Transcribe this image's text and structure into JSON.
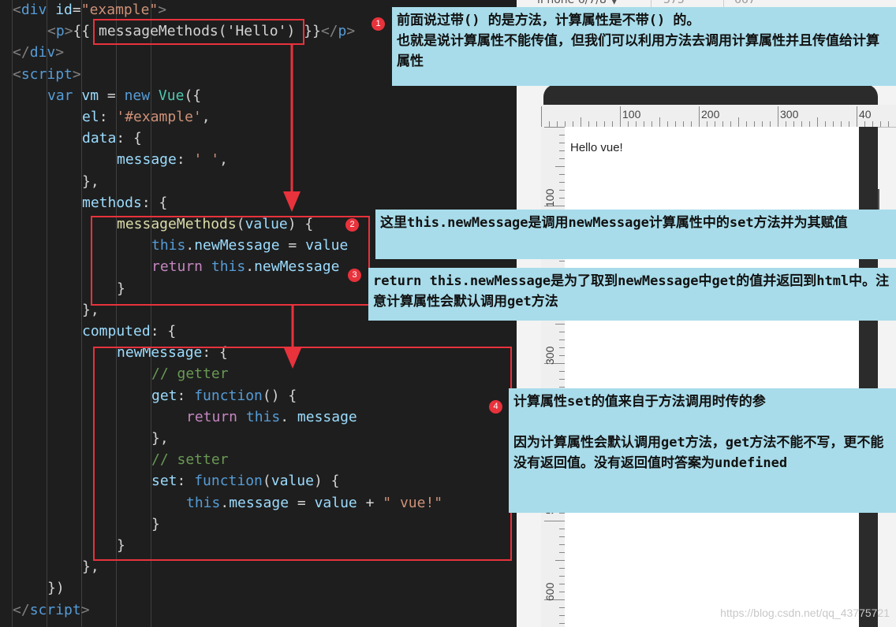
{
  "code": {
    "lines": [
      {
        "indent": 0,
        "tokens": [
          {
            "t": "<",
            "c": "punc"
          },
          {
            "t": "div ",
            "c": "tag"
          },
          {
            "t": "id",
            "c": "attr"
          },
          {
            "t": "=",
            "c": "txt"
          },
          {
            "t": "\"example\"",
            "c": "str"
          },
          {
            "t": ">",
            "c": "punc"
          }
        ]
      },
      {
        "indent": 1,
        "tokens": [
          {
            "t": "<",
            "c": "punc"
          },
          {
            "t": "p",
            "c": "tag"
          },
          {
            "t": ">",
            "c": "punc"
          },
          {
            "t": "{{ ",
            "c": "txt"
          },
          {
            "t": "messageMethods",
            "c": "txt"
          },
          {
            "t": "(",
            "c": "txt"
          },
          {
            "t": "'Hello'",
            "c": "txt"
          },
          {
            "t": ")",
            "c": "txt"
          },
          {
            "t": " }}",
            "c": "txt"
          },
          {
            "t": "</",
            "c": "punc"
          },
          {
            "t": "p",
            "c": "tag"
          },
          {
            "t": ">",
            "c": "punc"
          }
        ]
      },
      {
        "indent": 0,
        "tokens": [
          {
            "t": "</",
            "c": "punc"
          },
          {
            "t": "div",
            "c": "tag"
          },
          {
            "t": ">",
            "c": "punc"
          }
        ]
      },
      {
        "indent": 0,
        "tokens": [
          {
            "t": "<",
            "c": "punc"
          },
          {
            "t": "script",
            "c": "tag"
          },
          {
            "t": ">",
            "c": "punc"
          }
        ]
      },
      {
        "indent": 1,
        "tokens": [
          {
            "t": "var ",
            "c": "kw"
          },
          {
            "t": "vm",
            "c": "var"
          },
          {
            "t": " = ",
            "c": "txt"
          },
          {
            "t": "new ",
            "c": "kw"
          },
          {
            "t": "Vue",
            "c": "cls"
          },
          {
            "t": "({",
            "c": "txt"
          }
        ]
      },
      {
        "indent": 2,
        "tokens": [
          {
            "t": "el",
            "c": "var"
          },
          {
            "t": ": ",
            "c": "txt"
          },
          {
            "t": "'#example'",
            "c": "str"
          },
          {
            "t": ",",
            "c": "txt"
          }
        ]
      },
      {
        "indent": 2,
        "tokens": [
          {
            "t": "data",
            "c": "var"
          },
          {
            "t": ": {",
            "c": "txt"
          }
        ]
      },
      {
        "indent": 3,
        "tokens": [
          {
            "t": "message",
            "c": "var"
          },
          {
            "t": ": ",
            "c": "txt"
          },
          {
            "t": "' '",
            "c": "str"
          },
          {
            "t": ",",
            "c": "txt"
          }
        ]
      },
      {
        "indent": 2,
        "tokens": [
          {
            "t": "},",
            "c": "txt"
          }
        ]
      },
      {
        "indent": 2,
        "tokens": [
          {
            "t": "methods",
            "c": "var"
          },
          {
            "t": ": {",
            "c": "txt"
          }
        ]
      },
      {
        "indent": 3,
        "tokens": [
          {
            "t": "messageMethods",
            "c": "fn"
          },
          {
            "t": "(",
            "c": "txt"
          },
          {
            "t": "value",
            "c": "var"
          },
          {
            "t": ") {",
            "c": "txt"
          }
        ]
      },
      {
        "indent": 4,
        "tokens": [
          {
            "t": "this",
            "c": "kw"
          },
          {
            "t": ".",
            "c": "txt"
          },
          {
            "t": "newMessage",
            "c": "var"
          },
          {
            "t": " = ",
            "c": "txt"
          },
          {
            "t": "value",
            "c": "var"
          }
        ]
      },
      {
        "indent": 4,
        "tokens": [
          {
            "t": "return ",
            "c": "ctrl"
          },
          {
            "t": "this",
            "c": "kw"
          },
          {
            "t": ".",
            "c": "txt"
          },
          {
            "t": "newMessage",
            "c": "var"
          }
        ]
      },
      {
        "indent": 3,
        "tokens": [
          {
            "t": "}",
            "c": "txt"
          }
        ]
      },
      {
        "indent": 2,
        "tokens": [
          {
            "t": "},",
            "c": "txt"
          }
        ]
      },
      {
        "indent": 2,
        "tokens": [
          {
            "t": "computed",
            "c": "var"
          },
          {
            "t": ": {",
            "c": "txt"
          }
        ]
      },
      {
        "indent": 3,
        "tokens": [
          {
            "t": "newMessage",
            "c": "var"
          },
          {
            "t": ": {",
            "c": "txt"
          }
        ]
      },
      {
        "indent": 4,
        "tokens": [
          {
            "t": "// getter",
            "c": "com"
          }
        ]
      },
      {
        "indent": 4,
        "tokens": [
          {
            "t": "get",
            "c": "var"
          },
          {
            "t": ": ",
            "c": "txt"
          },
          {
            "t": "function",
            "c": "kw"
          },
          {
            "t": "() {",
            "c": "txt"
          }
        ]
      },
      {
        "indent": 5,
        "tokens": [
          {
            "t": "return ",
            "c": "ctrl"
          },
          {
            "t": "this",
            "c": "kw"
          },
          {
            "t": ". ",
            "c": "txt"
          },
          {
            "t": "message",
            "c": "var"
          }
        ]
      },
      {
        "indent": 4,
        "tokens": [
          {
            "t": "},",
            "c": "txt"
          }
        ]
      },
      {
        "indent": 4,
        "tokens": [
          {
            "t": "// setter",
            "c": "com"
          }
        ]
      },
      {
        "indent": 4,
        "tokens": [
          {
            "t": "set",
            "c": "var"
          },
          {
            "t": ": ",
            "c": "txt"
          },
          {
            "t": "function",
            "c": "kw"
          },
          {
            "t": "(",
            "c": "txt"
          },
          {
            "t": "value",
            "c": "var"
          },
          {
            "t": ") {",
            "c": "txt"
          }
        ]
      },
      {
        "indent": 5,
        "tokens": [
          {
            "t": "this",
            "c": "kw"
          },
          {
            "t": ".",
            "c": "txt"
          },
          {
            "t": "message",
            "c": "var"
          },
          {
            "t": " = ",
            "c": "txt"
          },
          {
            "t": "value",
            "c": "var"
          },
          {
            "t": " + ",
            "c": "txt"
          },
          {
            "t": "\" vue!\"",
            "c": "str"
          }
        ]
      },
      {
        "indent": 4,
        "tokens": [
          {
            "t": "}",
            "c": "txt"
          }
        ]
      },
      {
        "indent": 3,
        "tokens": [
          {
            "t": "}",
            "c": "txt"
          }
        ]
      },
      {
        "indent": 2,
        "tokens": [
          {
            "t": "},",
            "c": "txt"
          }
        ]
      },
      {
        "indent": 1,
        "tokens": [
          {
            "t": "})",
            "c": "txt"
          }
        ]
      },
      {
        "indent": 0,
        "tokens": [
          {
            "t": "</",
            "c": "punc"
          },
          {
            "t": "script",
            "c": "tag"
          },
          {
            "t": ">",
            "c": "punc"
          }
        ]
      }
    ]
  },
  "preview": {
    "device_name": "iPhone 6/7/8 ▼",
    "width": "375",
    "height": "667",
    "rendered_text": "Hello vue!",
    "ruler_top_labels": [
      "100",
      "200",
      "300",
      "40"
    ],
    "ruler_left_labels": [
      "100",
      "300",
      "5",
      "600"
    ],
    "watermark": "https://blog.csdn.net/qq_43775721"
  },
  "annotations": [
    {
      "badge": "1",
      "text": "前面说过带() 的是方法，计算属性是不带() 的。\n也就是说计算属性不能传值，但我们可以利用方法去调用计算属性并且传值给计算属性"
    },
    {
      "badge": "2",
      "text": "这里this.newMessage是调用newMessage计算属性中的set方法并为其赋值"
    },
    {
      "badge": "3",
      "text": "return this.newMessage是为了取到newMessage中get的值并返回到html中。注意计算属性会默认调用get方法"
    },
    {
      "badge": "4",
      "text": "计算属性set的值来自于方法调用时传的参\n\n因为计算属性会默认调用get方法，get方法不能不写，更不能没有返回值。没有返回值时答案为undefined"
    }
  ],
  "colors": {
    "highlight": "#e8323c",
    "note_bg": "#a8dcea",
    "editor_bg": "#1e1e1e"
  }
}
